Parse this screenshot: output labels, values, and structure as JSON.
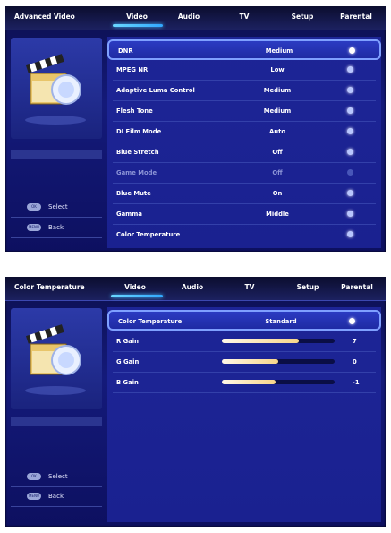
{
  "screen1": {
    "title": "Advanced Video",
    "tabs": [
      "Video",
      "Audio",
      "TV",
      "Setup",
      "Parental"
    ],
    "active_tab": "Video",
    "hints": {
      "select": "Select",
      "back": "Back"
    },
    "rows": [
      {
        "label": "DNR",
        "value": "Medium",
        "selected": true,
        "dim": false
      },
      {
        "label": "MPEG NR",
        "value": "Low",
        "selected": false,
        "dim": false
      },
      {
        "label": "Adaptive Luma Control",
        "value": "Medium",
        "selected": false,
        "dim": false
      },
      {
        "label": "Flesh Tone",
        "value": "Medium",
        "selected": false,
        "dim": false
      },
      {
        "label": "DI Film Mode",
        "value": "Auto",
        "selected": false,
        "dim": false
      },
      {
        "label": "Blue Stretch",
        "value": "Off",
        "selected": false,
        "dim": false
      },
      {
        "label": "Game Mode",
        "value": "Off",
        "selected": false,
        "dim": true
      },
      {
        "label": "Blue Mute",
        "value": "On",
        "selected": false,
        "dim": false
      },
      {
        "label": "Gamma",
        "value": "Middle",
        "selected": false,
        "dim": false
      },
      {
        "label": "Color Temperature",
        "value": "",
        "selected": false,
        "dim": false
      }
    ]
  },
  "screen2": {
    "title": "Color Temperature",
    "tabs": [
      "Video",
      "Audio",
      "TV",
      "Setup",
      "Parental"
    ],
    "active_tab": "Video",
    "hints": {
      "select": "Select",
      "back": "Back"
    },
    "header_row": {
      "label": "Color Temperature",
      "value": "Standard"
    },
    "gains": [
      {
        "label": "R Gain",
        "value": "7",
        "level": 0.68
      },
      {
        "label": "G Gain",
        "value": "0",
        "level": 0.5
      },
      {
        "label": "B Gain",
        "value": "-1",
        "level": 0.48
      }
    ]
  }
}
